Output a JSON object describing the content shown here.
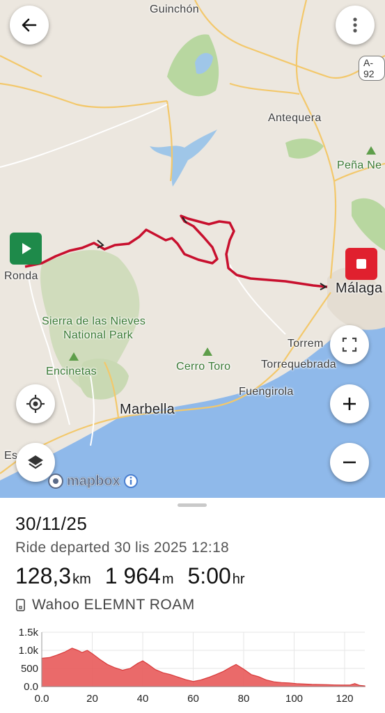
{
  "map": {
    "labels": {
      "guinchon": "Guinchón",
      "antequera": "Antequera",
      "pena": "Peña Ne",
      "ronda": "Ronda",
      "malaga": "Málaga",
      "sierra_line1": "Sierra de las Nieves",
      "sierra_line2": "National Park",
      "encinetas": "Encinetas",
      "cerro_toro": "Cerro Toro",
      "torrem": "Torrem",
      "torrequebrada": "Torrequebrada",
      "fuengirola": "Fuengirola",
      "marbella": "Marbella",
      "estepona": "Es",
      "road_a92": "A-92",
      "mapbox": "mapbox"
    },
    "icons": {
      "back": "arrow-left-icon",
      "menu": "more-vertical-icon",
      "start": "play-icon",
      "end": "stop-icon",
      "locate": "crosshair-icon",
      "layers": "layers-icon",
      "fullscreen": "fullscreen-icon",
      "zoom_in": "plus-icon",
      "zoom_out": "minus-icon",
      "info": "info-icon"
    },
    "colors": {
      "route": "#c8102e",
      "start_marker": "#1e8a4a",
      "end_marker": "#e0202e",
      "sea": "#8fb9ea"
    }
  },
  "ride": {
    "date": "30/11/25",
    "departed": "Ride departed 30 lis 2025 12:18",
    "distance_value": "128,3",
    "distance_unit": "km",
    "elevation_value": "1 964",
    "elevation_unit": "m",
    "duration_value": "5:00",
    "duration_unit": "hr",
    "device": "Wahoo ELEMNT ROAM"
  },
  "chart_data": {
    "type": "area",
    "title": "",
    "xlabel": "",
    "ylabel": "",
    "xlim": [
      0,
      128
    ],
    "ylim": [
      0,
      1500
    ],
    "x_ticks": [
      "0.0",
      "20",
      "40",
      "60",
      "80",
      "100",
      "120"
    ],
    "y_ticks": [
      "0.0",
      "500",
      "1.0k",
      "1.5k"
    ],
    "x_tick_values": [
      0,
      20,
      40,
      60,
      80,
      100,
      120
    ],
    "y_tick_values": [
      0,
      500,
      1000,
      1500
    ],
    "grid": true,
    "color": "#e85a5a",
    "series": [
      {
        "x": [
          0,
          3,
          6,
          9,
          12,
          14,
          16,
          18,
          20,
          23,
          26,
          29,
          32,
          35,
          38,
          40,
          42,
          45,
          48,
          51,
          54,
          57,
          60,
          63,
          66,
          69,
          72,
          75,
          77,
          80,
          83,
          86,
          89,
          92,
          95,
          98,
          101,
          104,
          107,
          110,
          113,
          116,
          119,
          122,
          124,
          126,
          128
        ],
        "y": [
          780,
          800,
          870,
          950,
          1060,
          1010,
          940,
          1000,
          910,
          750,
          610,
          520,
          450,
          500,
          640,
          710,
          620,
          470,
          380,
          330,
          260,
          190,
          140,
          180,
          250,
          330,
          420,
          540,
          610,
          480,
          330,
          270,
          180,
          130,
          110,
          100,
          80,
          70,
          60,
          55,
          50,
          45,
          40,
          40,
          80,
          30,
          20
        ]
      }
    ]
  }
}
